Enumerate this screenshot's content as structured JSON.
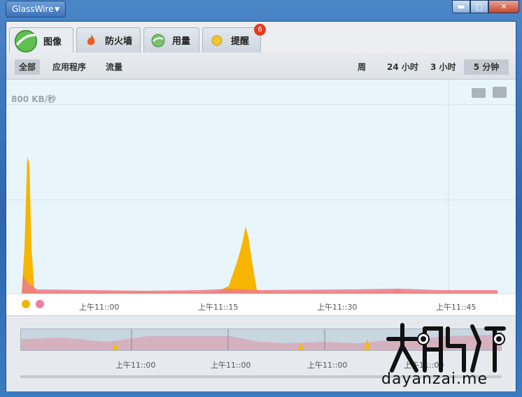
{
  "app": {
    "title": "GlassWire"
  },
  "window_buttons": {
    "minimize": "▬",
    "maximize": "▢",
    "close": "✕"
  },
  "tabs": [
    {
      "label": "图像",
      "icon": "graph-icon",
      "active": true
    },
    {
      "label": "防火墙",
      "icon": "fire-icon"
    },
    {
      "label": "用量",
      "icon": "usage-icon"
    },
    {
      "label": "提醒",
      "icon": "bulb-icon",
      "badge": "6"
    }
  ],
  "filters": {
    "left": [
      {
        "label": "全部",
        "selected": true
      },
      {
        "label": "应用程序"
      },
      {
        "label": "流量"
      }
    ],
    "right": [
      {
        "label": "周"
      },
      {
        "label": "24 小时"
      },
      {
        "label": "3 小时"
      },
      {
        "label": "5 分钟",
        "selected": true
      }
    ]
  },
  "graph": {
    "y_label": "800 KB/秒",
    "x_ticks": [
      "上午11::00",
      "上午11::15",
      "上午11::30",
      "上午11::45"
    ],
    "colors": {
      "download": "#f7b500",
      "upload": "#e96a8f",
      "background": "#e8f6fb"
    }
  },
  "overview": {
    "x_ticks": [
      "上午11::00",
      "上午11::00",
      "上午11::00",
      "上午11::00"
    ]
  },
  "watermark": {
    "text": "dayanzai.me"
  }
}
